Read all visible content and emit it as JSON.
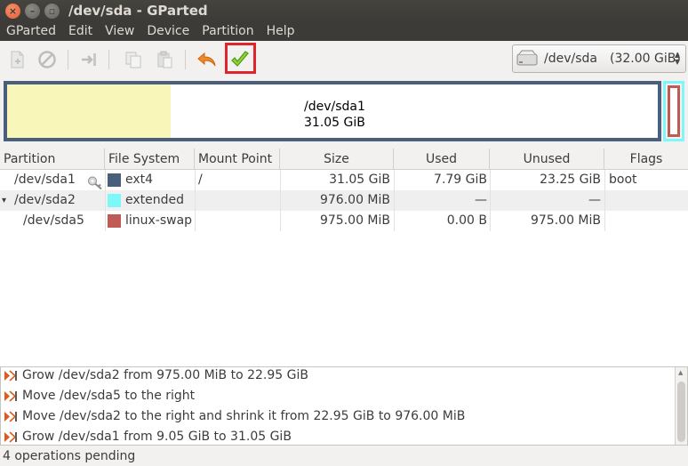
{
  "window": {
    "title": "/dev/sda - GParted",
    "close_glyph": "×",
    "min_glyph": "–",
    "max_glyph": "▫"
  },
  "menu": [
    "GParted",
    "Edit",
    "View",
    "Device",
    "Partition",
    "Help"
  ],
  "toolbar": {
    "device": {
      "name": "/dev/sda",
      "size": "(32.00 GiB)"
    }
  },
  "diskmap": {
    "partition_name": "/dev/sda1",
    "partition_size": "31.05 GiB",
    "used_fraction": 0.2509
  },
  "table": {
    "columns": [
      "Partition",
      "File System",
      "Mount Point",
      "Size",
      "Used",
      "Unused",
      "Flags"
    ],
    "rows": [
      {
        "partition": "/dev/sda1",
        "fs": "ext4",
        "fs_color": "#4a5f7b",
        "mount": "/",
        "size": "31.05 GiB",
        "used": "7.79 GiB",
        "unused": "23.25 GiB",
        "flags": "boot",
        "key_icon": true
      },
      {
        "partition": "/dev/sda2",
        "fs": "extended",
        "fs_color": "#7df8f8",
        "mount": "",
        "size": "976.00 MiB",
        "used": "—",
        "unused": "—",
        "flags": "",
        "expander": "▾"
      },
      {
        "partition": "/dev/sda5",
        "fs": "linux-swap",
        "fs_color": "#c05a55",
        "mount": "",
        "size": "975.00 MiB",
        "used": "0.00 B",
        "unused": "975.00 MiB",
        "flags": ""
      }
    ]
  },
  "operations": [
    "Grow /dev/sda2 from 975.00 MiB to 22.95 GiB",
    "Move /dev/sda5 to the right",
    "Move /dev/sda2 to the right and shrink it from 22.95 GiB to 976.00 MiB",
    "Grow /dev/sda1 from 9.05 GiB to 31.05 GiB"
  ],
  "status": "4 operations pending",
  "colors": {
    "ext4": "#4a5f7b",
    "extended": "#7df8f8",
    "linux_swap": "#c05a55",
    "used_space": "#f8f6b9",
    "apply_highlight": "#e0242d"
  }
}
